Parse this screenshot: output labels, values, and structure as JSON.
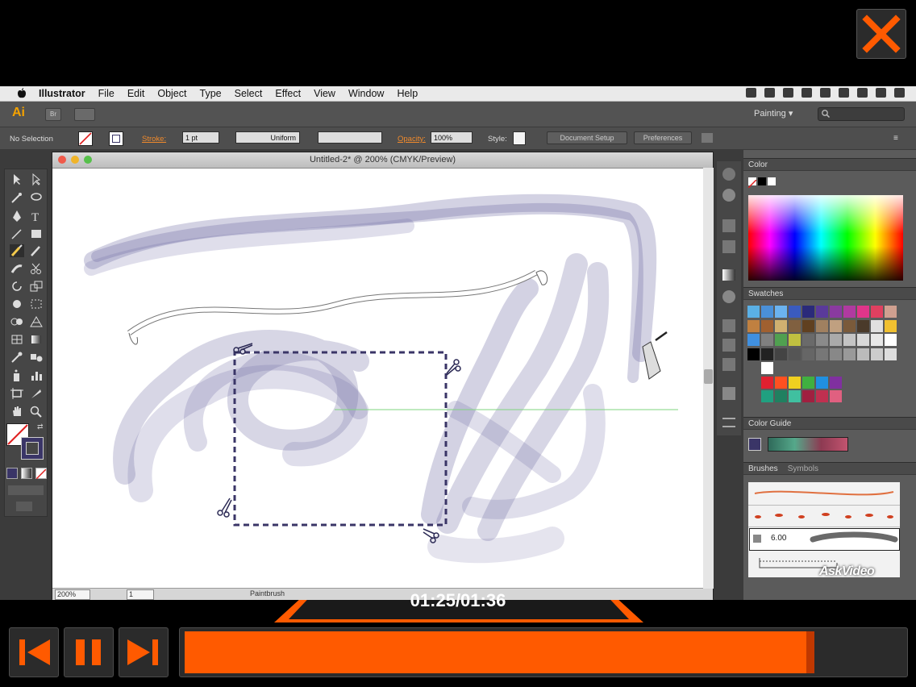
{
  "menubar": {
    "app": "Illustrator",
    "items": [
      "File",
      "Edit",
      "Object",
      "Type",
      "Select",
      "Effect",
      "View",
      "Window",
      "Help"
    ]
  },
  "appbar": {
    "logo": "Ai",
    "bridge": "Br",
    "workspace": "Painting"
  },
  "control": {
    "selection": "No Selection",
    "stroke_label": "Stroke:",
    "stroke_value": "1 pt",
    "profile": "Uniform",
    "opacity_label": "Opacity:",
    "opacity_value": "100%",
    "style_label": "Style:",
    "document_setup": "Document Setup",
    "preferences": "Preferences"
  },
  "document": {
    "title": "Untitled-2* @ 200% (CMYK/Preview)",
    "zoom": "200%",
    "artboard": "1",
    "status_tool": "Paintbrush",
    "colors": {
      "stroke": "#6e6ba2",
      "dash": "#3a3567",
      "guide": "#7fd47f"
    }
  },
  "panels": {
    "color_title": "Color",
    "swatches_title": "Swatches",
    "color_guide_title": "Color Guide",
    "brushes_tab": "Brushes",
    "symbols_tab": "Symbols",
    "brush_size": "6.00"
  },
  "player": {
    "time": "01:25/01:36",
    "progress": 0.875,
    "accent": "#ff5a00",
    "watermark": "AskVideo"
  }
}
